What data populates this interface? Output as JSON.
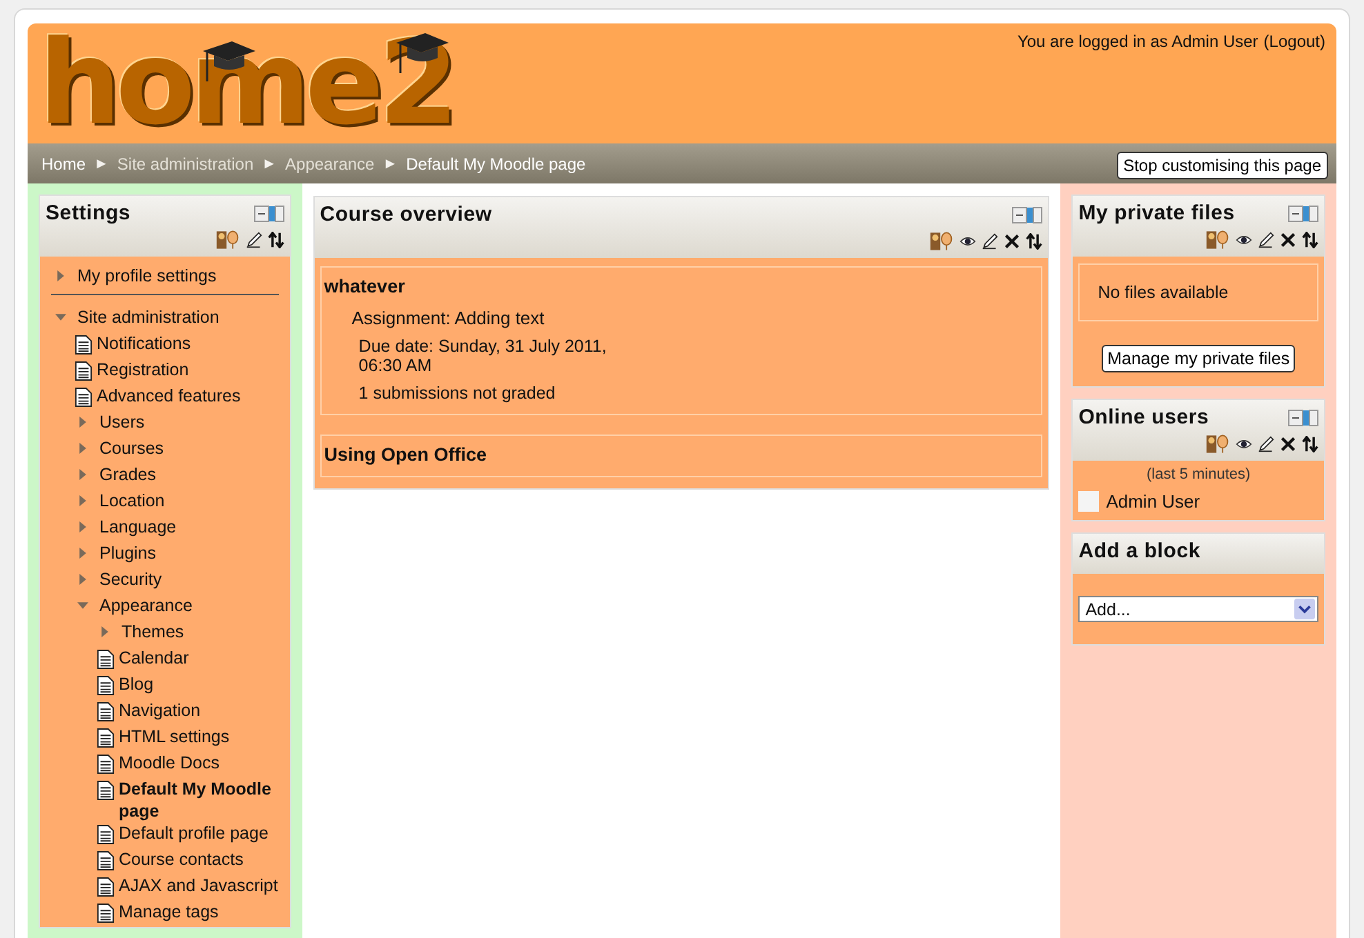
{
  "header": {
    "logo": "home2",
    "login_text": "You are logged in as Admin User",
    "logout_link": "(Logout)"
  },
  "breadcrumb": {
    "items": [
      {
        "label": "Home",
        "dimmed": false
      },
      {
        "label": "Site administration",
        "dimmed": true
      },
      {
        "label": "Appearance",
        "dimmed": true
      },
      {
        "label": "Default My Moodle page",
        "dimmed": false
      }
    ],
    "separator": "►",
    "button": "Stop customising this page"
  },
  "settings_block": {
    "title": "Settings",
    "controls": [
      {
        "kind": "roles"
      },
      {
        "kind": "edit"
      },
      {
        "kind": "move"
      }
    ],
    "tree": [
      {
        "label": "My profile settings",
        "kind": "branch",
        "expanded": false,
        "selected": false,
        "divider_after": true
      },
      {
        "label": "Site administration",
        "kind": "branch",
        "expanded": true,
        "selected": false,
        "children": [
          {
            "label": "Notifications",
            "kind": "leaf",
            "selected": false
          },
          {
            "label": "Registration",
            "kind": "leaf",
            "selected": false
          },
          {
            "label": "Advanced features",
            "kind": "leaf",
            "selected": false
          },
          {
            "label": "Users",
            "kind": "branch",
            "expanded": false,
            "selected": false
          },
          {
            "label": "Courses",
            "kind": "branch",
            "expanded": false,
            "selected": false
          },
          {
            "label": "Grades",
            "kind": "branch",
            "expanded": false,
            "selected": false
          },
          {
            "label": "Location",
            "kind": "branch",
            "expanded": false,
            "selected": false
          },
          {
            "label": "Language",
            "kind": "branch",
            "expanded": false,
            "selected": false
          },
          {
            "label": "Plugins",
            "kind": "branch",
            "expanded": false,
            "selected": false
          },
          {
            "label": "Security",
            "kind": "branch",
            "expanded": false,
            "selected": false
          },
          {
            "label": "Appearance",
            "kind": "branch",
            "expanded": true,
            "selected": false,
            "children": [
              {
                "label": "Themes",
                "kind": "branch",
                "expanded": false,
                "selected": false
              },
              {
                "label": "Calendar",
                "kind": "leaf",
                "selected": false
              },
              {
                "label": "Blog",
                "kind": "leaf",
                "selected": false
              },
              {
                "label": "Navigation",
                "kind": "leaf",
                "selected": false
              },
              {
                "label": "HTML settings",
                "kind": "leaf",
                "selected": false
              },
              {
                "label": "Moodle Docs",
                "kind": "leaf",
                "selected": false
              },
              {
                "label": "Default My Moodle page",
                "kind": "leaf",
                "selected": true
              },
              {
                "label": "Default profile page",
                "kind": "leaf",
                "selected": false
              },
              {
                "label": "Course contacts",
                "kind": "leaf",
                "selected": false
              },
              {
                "label": "AJAX and Javascript",
                "kind": "leaf",
                "selected": false
              },
              {
                "label": "Manage tags",
                "kind": "leaf",
                "selected": false
              }
            ]
          }
        ]
      }
    ]
  },
  "course_overview": {
    "title": "Course overview",
    "controls": [
      {
        "kind": "roles"
      },
      {
        "kind": "hide"
      },
      {
        "kind": "edit"
      },
      {
        "kind": "delete"
      },
      {
        "kind": "move"
      }
    ],
    "courses": [
      {
        "name": "whatever",
        "assignment": "Assignment: Adding text",
        "due": "Due date: Sunday, 31 July 2011, 06:30 AM",
        "status": "1 submissions not graded"
      },
      {
        "name": "Using Open Office"
      }
    ]
  },
  "private_files": {
    "title": "My private files",
    "controls": [
      {
        "kind": "roles"
      },
      {
        "kind": "hide"
      },
      {
        "kind": "edit"
      },
      {
        "kind": "delete"
      },
      {
        "kind": "move"
      }
    ],
    "message": "No files available",
    "button": "Manage my private files"
  },
  "online_users": {
    "title": "Online users",
    "controls": [
      {
        "kind": "roles"
      },
      {
        "kind": "hide"
      },
      {
        "kind": "edit"
      },
      {
        "kind": "delete"
      },
      {
        "kind": "move"
      }
    ],
    "period": "(last 5 minutes)",
    "users": [
      {
        "name": "Admin User"
      }
    ]
  },
  "add_block": {
    "title": "Add a block",
    "select": {
      "value": "Add..."
    }
  }
}
